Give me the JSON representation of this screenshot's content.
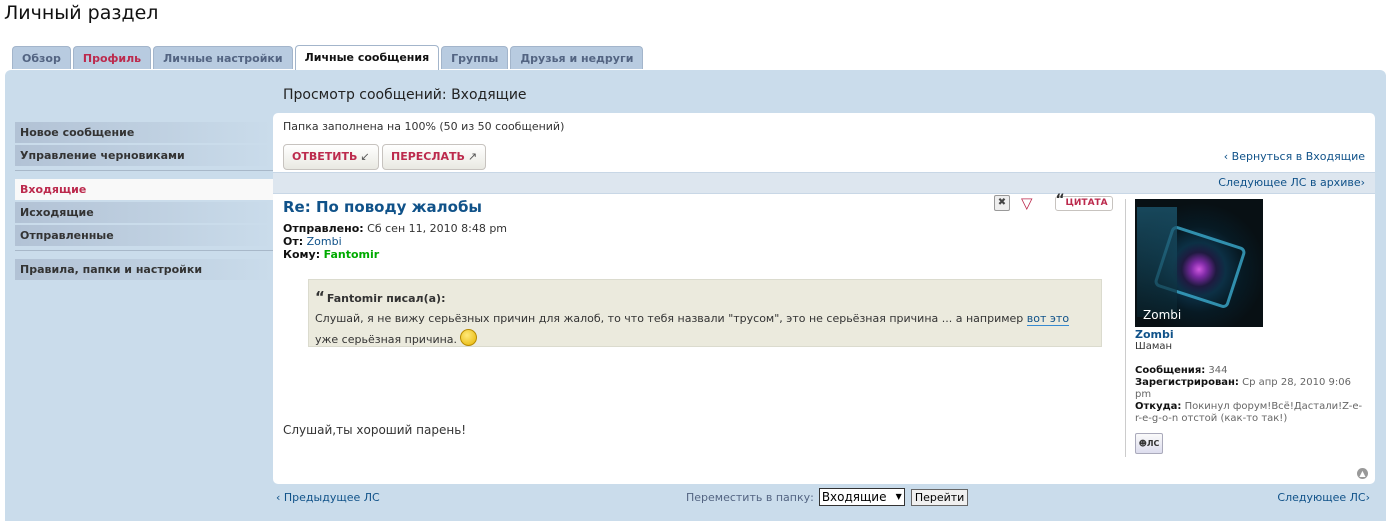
{
  "page_title": "Личный раздел",
  "tabs": [
    "Обзор",
    "Профиль",
    "Личные настройки",
    "Личные сообщения",
    "Группы",
    "Друзья и недруги"
  ],
  "sidebar": {
    "new_message": "Новое сообщение",
    "drafts": "Управление черновиками",
    "inbox": "Входящие",
    "outbox": "Исходящие",
    "sent": "Отправленные",
    "rules": "Правила, папки и настройки"
  },
  "content_title": "Просмотр сообщений: Входящие",
  "folder_info": "Папка заполнена на 100% (50 из 50 сообщений)",
  "buttons": {
    "reply": "ОТВЕТИТЬ",
    "forward": "ПЕРЕСЛАТЬ"
  },
  "return_link": "Вернуться в Входящие",
  "archive_link": "Следующее ЛС в архиве",
  "post": {
    "title": "Re: По поводу жалобы",
    "quote_label": "ЦИТАТА",
    "sent_label": "Отправлено:",
    "sent_value": "Сб сен 11, 2010 8:48 pm",
    "from_label": "От:",
    "from_value": "Zombi",
    "to_label": "Кому:",
    "to_value": "Fantomir",
    "quote_author": "Fantomir писал(а):",
    "quote_text": "Слушай, я не вижу серьёзных причин для жалоб, то что тебя назвали \"трусом\", это не серьёзная причина ... а например",
    "quote_link": "вот это",
    "quote_tail": "уже серьёзная причина.",
    "body": "Слушай,ты хороший парень!"
  },
  "profile": {
    "avatar_caption": "Zombi",
    "username": "Zombi",
    "rank": "Шаман",
    "posts_label": "Сообщения:",
    "posts_value": "344",
    "registered_label": "Зарегистрирован:",
    "registered_value": "Ср апр 28, 2010 9:06 pm",
    "location_label": "Откуда:",
    "location_value": "Покинул форум!Всё!Дастали!Z-e-r-e-g-o-n отстой (как-то так!)",
    "pm_label": "ЛС"
  },
  "nav": {
    "prev": "Предыдущее ЛС",
    "next": "Следующее ЛС",
    "move_label": "Переместить в папку:",
    "move_select": "Входящие",
    "go": "Перейти"
  }
}
